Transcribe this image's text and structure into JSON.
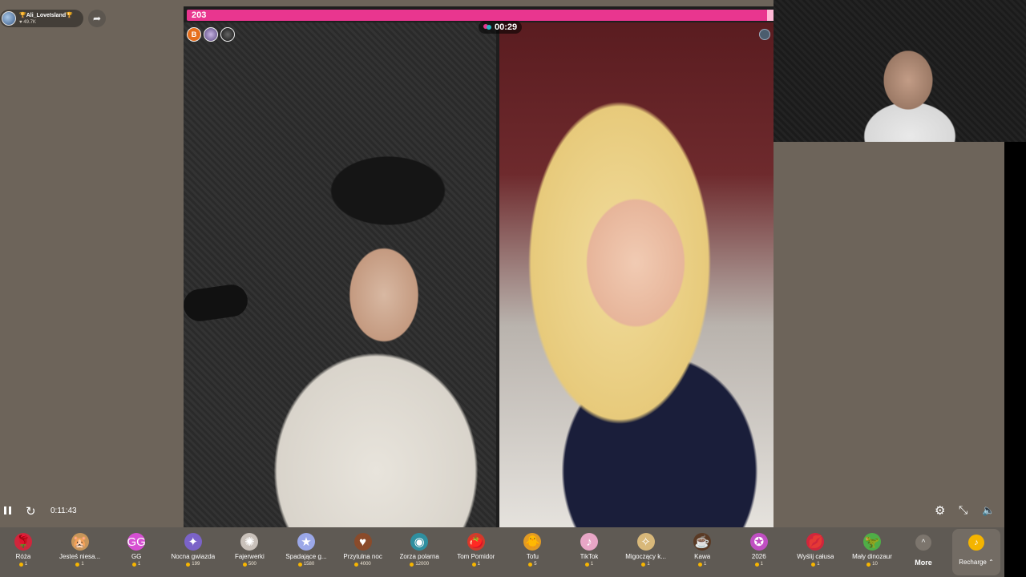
{
  "host": {
    "name": "🏆Ali_LoveIsland🏆",
    "likes": "♥ 49.7K"
  },
  "battle": {
    "score": "203",
    "timer": "00:29",
    "supporter_badge": "B"
  },
  "player": {
    "time": "0:11:43"
  },
  "gifts": [
    {
      "icon": "🌹",
      "name": "Róża",
      "price": "1",
      "color": "#d0263c"
    },
    {
      "icon": "🐹",
      "name": "Jesteś niesa...",
      "price": "1",
      "color": "#c7955a"
    },
    {
      "icon": "GG",
      "name": "GG",
      "price": "1",
      "color": "#d64fd2"
    },
    {
      "icon": "✦",
      "name": "Nocna gwiazda",
      "price": "199",
      "color": "#7b63c8"
    },
    {
      "icon": "✺",
      "name": "Fajerwerki",
      "price": "500",
      "color": "#c9c1ba"
    },
    {
      "icon": "★",
      "name": "Spadające g...",
      "price": "1580",
      "color": "#9ba8e8"
    },
    {
      "icon": "♥",
      "name": "Przytulna noc",
      "price": "4000",
      "color": "#8a4b2b"
    },
    {
      "icon": "◉",
      "name": "Zorza polarna",
      "price": "12000",
      "color": "#2f8f9f"
    },
    {
      "icon": "🍅",
      "name": "Tom Pomidor",
      "price": "1",
      "color": "#d23a2b"
    },
    {
      "icon": "🐥",
      "name": "Tofu",
      "price": "5",
      "color": "#e39b23"
    },
    {
      "icon": "♪",
      "name": "TikTok",
      "price": "1",
      "color": "#e8a6c6"
    },
    {
      "icon": "✧",
      "name": "Migoczący k...",
      "price": "1",
      "color": "#d8b87a"
    },
    {
      "icon": "☕",
      "name": "Kawa",
      "price": "1",
      "color": "#5a3a25"
    },
    {
      "icon": "✪",
      "name": "2026",
      "price": "1",
      "color": "#c04fc2"
    },
    {
      "icon": "💋",
      "name": "Wyślij całusa",
      "price": "1",
      "color": "#d0263c"
    },
    {
      "icon": "🦖",
      "name": "Mały dinozaur",
      "price": "10",
      "color": "#4fae47"
    }
  ],
  "more_label": "More",
  "recharge_label": "Recharge ⌃"
}
